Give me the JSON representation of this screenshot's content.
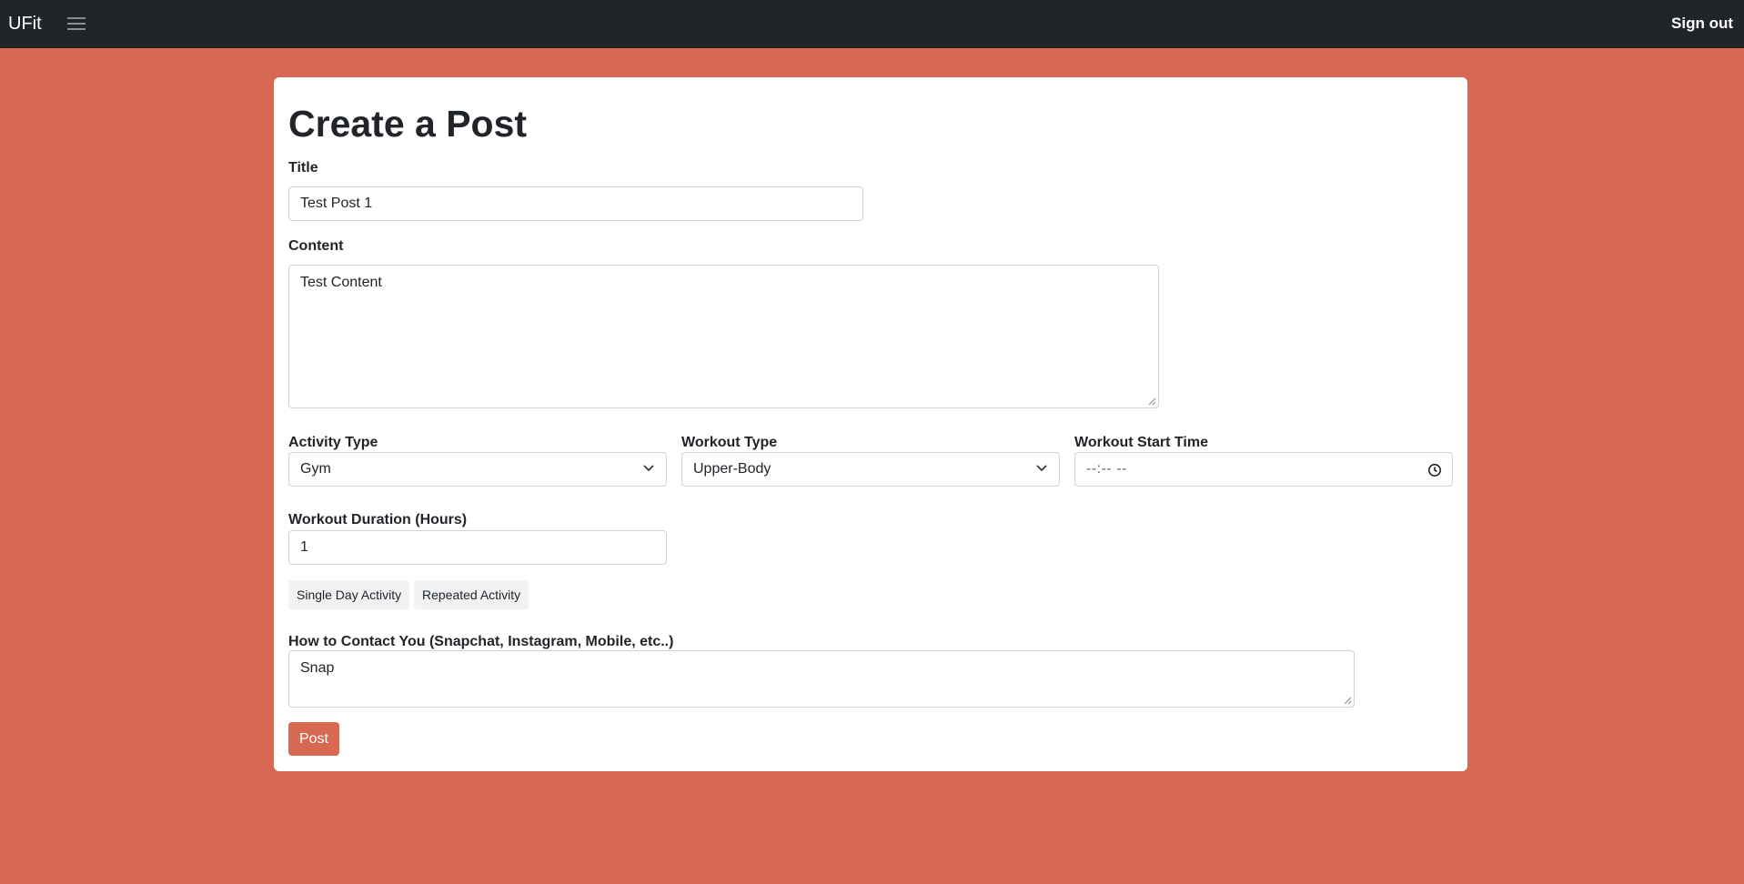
{
  "navbar": {
    "brand": "UFit",
    "menu_icon": "hamburger-menu-icon",
    "signout_label": "Sign out"
  },
  "form": {
    "heading": "Create a Post",
    "title_field": {
      "label": "Title",
      "value": "Test Post 1"
    },
    "content_field": {
      "label": "Content",
      "value": "Test Content"
    },
    "activity_type": {
      "label": "Activity Type",
      "selected": "Gym"
    },
    "workout_type": {
      "label": "Workout Type",
      "selected": "Upper-Body"
    },
    "workout_start_time": {
      "label": "Workout Start Time",
      "placeholder": "--:-- --",
      "icon": "clock-icon"
    },
    "workout_duration": {
      "label": "Workout Duration (Hours)",
      "value": "1"
    },
    "frequency_options": [
      "Single Day Activity",
      "Repeated Activity"
    ],
    "contact_field": {
      "label": "How to Contact You (Snapchat, Instagram, Mobile, etc..)",
      "value": "Snap"
    },
    "submit_label": "Post"
  },
  "colors": {
    "background": "#d76852",
    "navbar": "#212529",
    "accent": "#d76852",
    "card": "#ffffff"
  }
}
